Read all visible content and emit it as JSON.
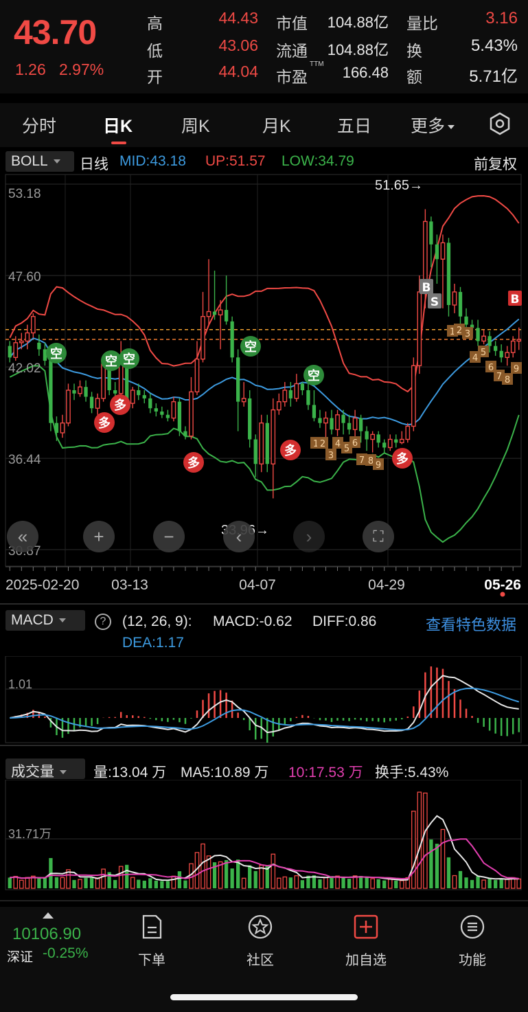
{
  "quote": {
    "price": "43.70",
    "change": "1.26",
    "change_pct": "2.97%",
    "rows": [
      {
        "l1": "高",
        "v1": "44.43",
        "l2": "市值",
        "v2": "104.88亿",
        "l3": "量比",
        "v3": "3.16"
      },
      {
        "l1": "低",
        "v1": "43.06",
        "l2": "流通",
        "v2": "104.88亿",
        "l3": "换",
        "v3": "5.43%"
      },
      {
        "l1": "开",
        "v1": "44.04",
        "l2": "市盈",
        "l2_sup": "TTM",
        "v2": "166.48",
        "l3": "额",
        "v3": "5.71亿"
      }
    ]
  },
  "tabs": [
    "分时",
    "日K",
    "周K",
    "月K",
    "五日",
    "更多"
  ],
  "active_tab": "日K",
  "settings_icon": "settings-hexagon-icon",
  "boll": {
    "name": "BOLL",
    "period": "日线",
    "mid": "MID:43.18",
    "up": "UP:51.57",
    "low": "LOW:34.79",
    "adjust": "前复权",
    "colors": {
      "mid": "#3d9be0",
      "up": "#f04a45",
      "low": "#3bb34a"
    }
  },
  "chart_data": [
    {
      "type": "candlestick",
      "y_ticks": [
        "53.18",
        "47.60",
        "42.02",
        "36.44",
        "30.87"
      ],
      "ylim": [
        30.87,
        53.18
      ],
      "x_labels": [
        "2025-02-20",
        "03-13",
        "04-07",
        "04-29",
        "05-26"
      ],
      "max_annotation": "51.65→",
      "min_annotation": "33.96→",
      "candles": [
        [
          43.3,
          42.6,
          43.6,
          42.3
        ],
        [
          42.6,
          43.5,
          43.9,
          42.4
        ],
        [
          43.5,
          43.6,
          44.1,
          43.1
        ],
        [
          43.6,
          44.1,
          44.6,
          43.1
        ],
        [
          44.1,
          45.1,
          45.3,
          43.8
        ],
        [
          43.5,
          43.1,
          44.0,
          42.7
        ],
        [
          43.1,
          42.4,
          43.5,
          42.1
        ],
        [
          42.4,
          38.6,
          42.7,
          38.1
        ],
        [
          38.6,
          38.0,
          39.0,
          37.5
        ],
        [
          38.0,
          38.6,
          39.1,
          37.7
        ],
        [
          38.6,
          40.6,
          41.0,
          38.4
        ],
        [
          40.6,
          40.4,
          41.0,
          40.0
        ],
        [
          40.4,
          40.8,
          41.2,
          40.2
        ],
        [
          40.8,
          40.2,
          41.2,
          39.9
        ],
        [
          40.2,
          39.5,
          40.5,
          39.2
        ],
        [
          39.5,
          40.1,
          40.4,
          39.1
        ],
        [
          40.1,
          42.2,
          42.6,
          39.9
        ],
        [
          42.2,
          40.6,
          42.5,
          40.3
        ],
        [
          40.6,
          40.4,
          41.1,
          40.1
        ],
        [
          40.4,
          42.6,
          43.6,
          40.2
        ],
        [
          42.6,
          39.8,
          43.0,
          39.6
        ],
        [
          39.8,
          40.6,
          40.8,
          39.5
        ],
        [
          40.6,
          40.3,
          41.0,
          40.0
        ],
        [
          40.3,
          40.1,
          40.6,
          39.8
        ],
        [
          40.1,
          39.5,
          40.4,
          39.2
        ],
        [
          39.5,
          39.3,
          39.8,
          39.0
        ],
        [
          39.3,
          39.1,
          39.6,
          38.9
        ],
        [
          39.1,
          38.9,
          39.4,
          38.7
        ],
        [
          38.9,
          39.9,
          40.2,
          38.7
        ],
        [
          39.9,
          38.1,
          40.1,
          37.8
        ],
        [
          38.1,
          37.8,
          38.4,
          37.6
        ],
        [
          37.8,
          40.5,
          41.4,
          37.6
        ],
        [
          40.5,
          42.5,
          43.6,
          40.3
        ],
        [
          42.5,
          45.1,
          46.6,
          42.3
        ],
        [
          45.1,
          45.4,
          48.6,
          44.6
        ],
        [
          45.4,
          45.2,
          47.9,
          44.9
        ],
        [
          45.2,
          45.5,
          46.1,
          43.1
        ],
        [
          45.5,
          44.8,
          47.6,
          44.6
        ],
        [
          44.8,
          42.6,
          45.1,
          42.3
        ],
        [
          42.6,
          39.9,
          43.1,
          38.1
        ],
        [
          39.9,
          40.1,
          41.1,
          39.6
        ],
        [
          40.1,
          37.6,
          40.6,
          37.1
        ],
        [
          37.6,
          36.1,
          37.9,
          35.3
        ],
        [
          36.1,
          38.6,
          39.1,
          35.6
        ],
        [
          38.6,
          36.1,
          39.1,
          35.6
        ],
        [
          36.1,
          39.4,
          40.1,
          34.0
        ],
        [
          39.4,
          39.9,
          40.4,
          39.1
        ],
        [
          39.9,
          40.6,
          41.1,
          39.6
        ],
        [
          40.6,
          40.1,
          41.1,
          39.6
        ],
        [
          40.1,
          41.0,
          41.6,
          39.9
        ],
        [
          41.0,
          40.6,
          41.1,
          40.3
        ],
        [
          40.6,
          39.7,
          41.1,
          39.4
        ],
        [
          39.7,
          38.9,
          40.6,
          38.7
        ],
        [
          38.9,
          38.6,
          39.4,
          38.3
        ],
        [
          38.6,
          38.9,
          39.3,
          37.6
        ],
        [
          38.9,
          38.2,
          39.4,
          37.9
        ],
        [
          38.2,
          39.1,
          39.4,
          37.8
        ],
        [
          39.1,
          38.6,
          39.4,
          37.9
        ],
        [
          38.6,
          38.2,
          39.1,
          37.9
        ],
        [
          38.2,
          38.9,
          39.4,
          37.6
        ],
        [
          38.9,
          38.1,
          39.1,
          37.4
        ],
        [
          38.1,
          37.6,
          38.4,
          36.9
        ],
        [
          37.6,
          37.9,
          38.1,
          36.8
        ],
        [
          37.9,
          37.4,
          38.1,
          37.1
        ],
        [
          37.4,
          37.1,
          37.6,
          36.8
        ],
        [
          37.1,
          37.6,
          37.9,
          36.9
        ],
        [
          37.6,
          37.4,
          37.9,
          37.1
        ],
        [
          37.4,
          37.6,
          38.1,
          37.3
        ],
        [
          37.6,
          38.4,
          38.6,
          37.4
        ],
        [
          38.4,
          42.1,
          42.6,
          38.1
        ],
        [
          42.1,
          46.6,
          47.6,
          41.6
        ],
        [
          46.6,
          50.9,
          51.65,
          45.6
        ],
        [
          50.9,
          49.5,
          51.2,
          48.1
        ],
        [
          49.5,
          48.6,
          50.1,
          47.1
        ],
        [
          48.6,
          49.6,
          50.1,
          45.6
        ],
        [
          49.6,
          45.8,
          49.9,
          45.1
        ],
        [
          45.8,
          46.6,
          47.1,
          45.3
        ],
        [
          46.6,
          45.1,
          46.9,
          44.3
        ],
        [
          45.1,
          44.6,
          45.6,
          44.1
        ],
        [
          44.6,
          44.4,
          44.9,
          43.9
        ],
        [
          44.4,
          43.6,
          44.9,
          43.3
        ],
        [
          43.6,
          43.9,
          44.3,
          43.4
        ],
        [
          43.9,
          43.3,
          44.2,
          42.9
        ],
        [
          43.3,
          43.0,
          43.6,
          42.7
        ],
        [
          43.0,
          42.6,
          43.4,
          42.3
        ],
        [
          42.6,
          42.9,
          43.3,
          42.1
        ],
        [
          42.9,
          43.6,
          43.9,
          42.6
        ],
        [
          43.6,
          43.7,
          44.43,
          43.06
        ]
      ]
    },
    {
      "type": "macd",
      "title": "MACD",
      "params": "(12, 26, 9):",
      "macd": "MACD:-0.62",
      "diff": "DIFF:0.86",
      "dea": "DEA:1.17",
      "y_tick": "1.01",
      "link": "查看特色数据"
    },
    {
      "type": "volume",
      "title": "成交量",
      "vol": "量:13.04 万",
      "ma5": "MA5:10.89 万",
      "ma10": "10:17.53 万",
      "turnover": "换手:5.43%",
      "y_tick": "31.71万"
    }
  ],
  "signals": {
    "duo": "多",
    "kong": "空",
    "buy": "B",
    "sell": "S"
  },
  "controls": [
    "«",
    "+",
    "−",
    "‹",
    "›",
    "⛶"
  ],
  "index": {
    "value": "10106.90",
    "name": "深证",
    "change": "-0.25%"
  },
  "nav": [
    {
      "label": "下单",
      "icon": "order-icon"
    },
    {
      "label": "社区",
      "icon": "community-star-icon"
    },
    {
      "label": "加自选",
      "icon": "add-watchlist-icon"
    },
    {
      "label": "功能",
      "icon": "menu-list-icon"
    }
  ],
  "colors": {
    "up": "#f04a45",
    "down": "#3bb34a",
    "bg": "#000000",
    "panel": "#0d0d0d"
  }
}
